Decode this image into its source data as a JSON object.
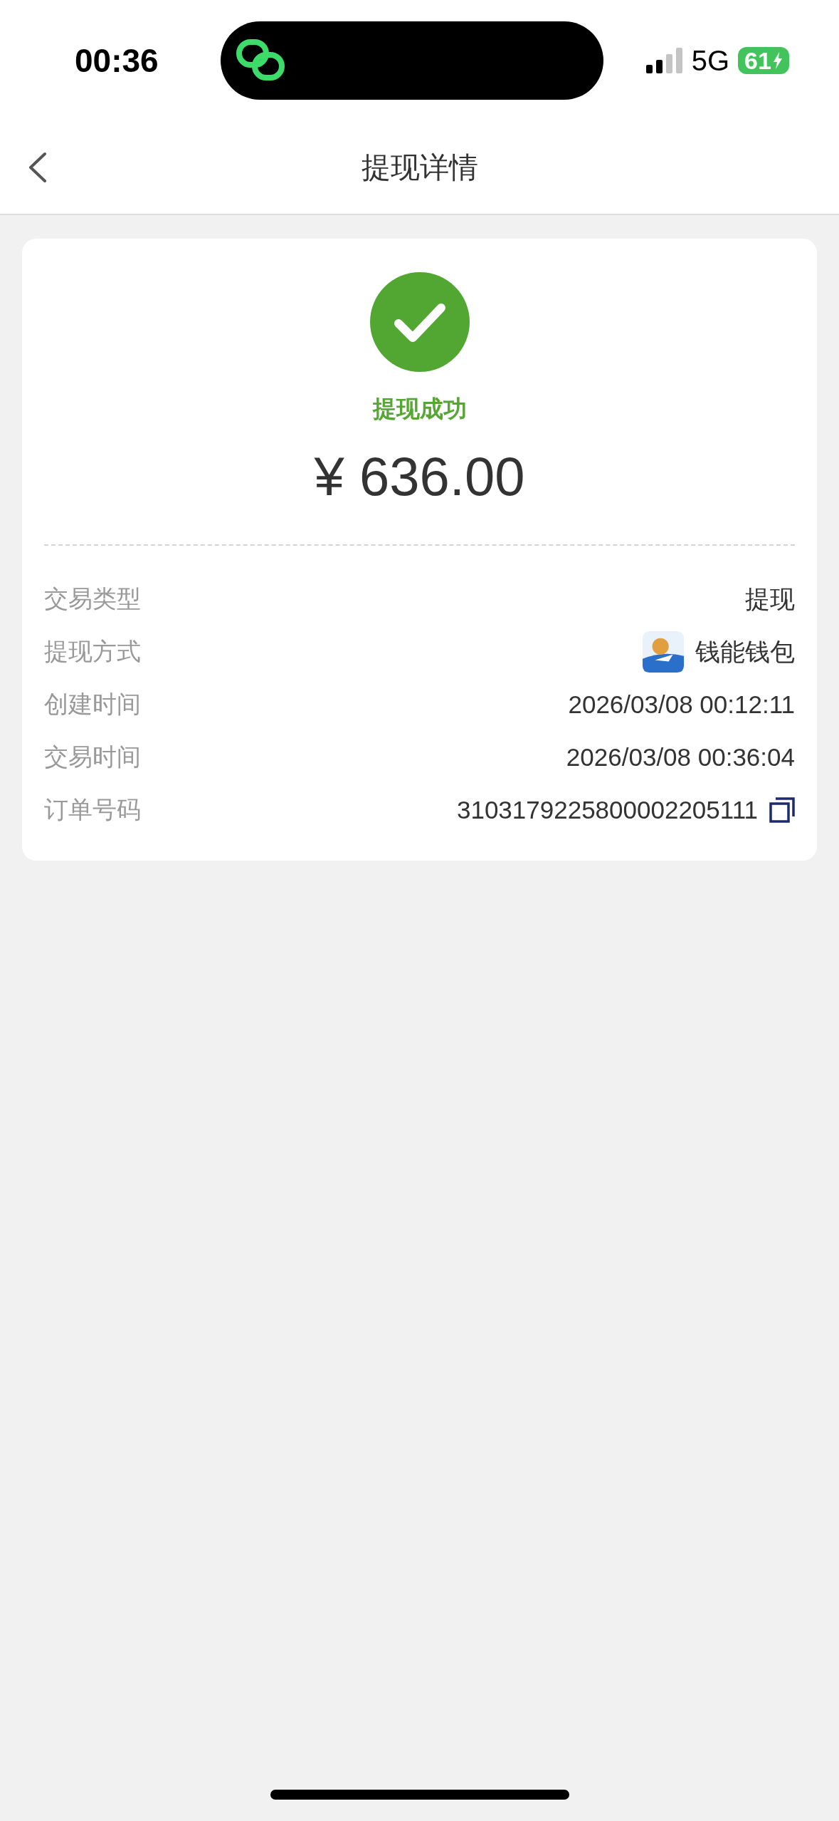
{
  "status_bar": {
    "time": "00:36",
    "network": "5G",
    "battery": "61"
  },
  "nav": {
    "title": "提现详情"
  },
  "result": {
    "successful": true,
    "status_text": "提现成功",
    "amount": "¥ 636.00"
  },
  "details": [
    {
      "kind": "text",
      "label": "交易类型",
      "value": "提现"
    },
    {
      "kind": "app",
      "label": "提现方式",
      "value": "钱能钱包"
    },
    {
      "kind": "text",
      "label": "创建时间",
      "value": "2026/03/08 00:12:11"
    },
    {
      "kind": "text",
      "label": "交易时间",
      "value": "2026/03/08 00:36:04"
    },
    {
      "kind": "copy",
      "label": "订单号码",
      "value": "3103179225800002205111"
    }
  ]
}
